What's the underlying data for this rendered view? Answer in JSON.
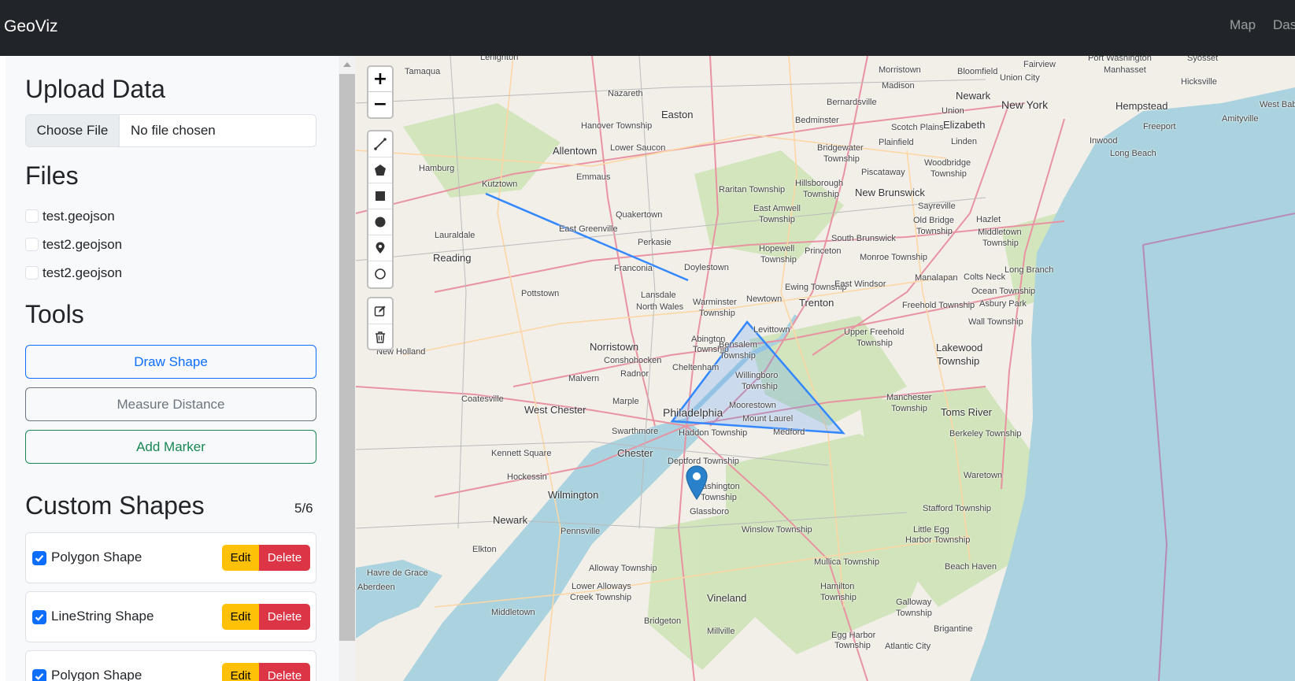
{
  "navbar": {
    "brand": "GeoViz",
    "links": [
      {
        "label": "Map"
      },
      {
        "label": "Dash"
      }
    ]
  },
  "upload": {
    "title": "Upload Data",
    "choose_label": "Choose File",
    "status": "No file chosen"
  },
  "files": {
    "title": "Files",
    "items": [
      {
        "label": "test.geojson"
      },
      {
        "label": "test2.geojson"
      },
      {
        "label": "test2.geojson"
      }
    ]
  },
  "tools": {
    "title": "Tools",
    "draw_shape": "Draw Shape",
    "measure_distance": "Measure Distance",
    "add_marker": "Add Marker"
  },
  "custom_shapes": {
    "title": "Custom Shapes",
    "count": "5/6",
    "edit_label": "Edit",
    "delete_label": "Delete",
    "items": [
      {
        "label": "Polygon Shape",
        "checked": true
      },
      {
        "label": "LineString Shape",
        "checked": true
      },
      {
        "label": "Polygon Shape",
        "checked": true
      }
    ]
  },
  "map": {
    "zoom_in": "+",
    "zoom_out": "−",
    "draw_tools": [
      "polyline-icon",
      "polygon-icon",
      "rectangle-icon",
      "circle-icon",
      "marker-icon",
      "circlemarker-icon"
    ],
    "edit_tools": [
      "edit-icon",
      "trash-icon"
    ],
    "places": {
      "lehighton": "Lehighton",
      "tamaqua": "Tamaqua",
      "nazareth": "Nazareth",
      "easton": "Easton",
      "hanover": "Hanover Township",
      "allentown": "Allentown",
      "lower_saucon": "Lower Saucon",
      "emmaus": "Emmaus",
      "hamburg": "Hamburg",
      "kutztown": "Kutztown",
      "quakertown": "Quakertown",
      "east_greenville": "East Greenville",
      "perkasie": "Perkasie",
      "lauraldale": "Lauraldale",
      "reading": "Reading",
      "franconia": "Franconia",
      "doylestown": "Doylestown",
      "pottstown": "Pottstown",
      "lansdale": "Lansdale",
      "north_wales": "North Wales",
      "warminster": "Warminster",
      "warminster_twp": "Township",
      "newtown": "Newtown",
      "trenton": "Trenton",
      "ewing": "Ewing Township",
      "levittown": "Levittown",
      "abington": "Abington",
      "abington_twp": "Township",
      "bensalem": "Bensalem",
      "bensalem_twp": "Township",
      "norristown": "Norristown",
      "conshohocken": "Conshohocken",
      "cheltenham": "Cheltenham",
      "new_holland": "New Holland",
      "malvern": "Malvern",
      "radnor": "Radnor",
      "willingboro": "Willingboro",
      "willingboro_twp": "Township",
      "coatesville": "Coatesville",
      "west_chester": "West Chester",
      "marple": "Marple",
      "philadelphia": "Philadelphia",
      "moorestown": "Moorestown",
      "mount_laurel": "Mount Laurel",
      "swarthmore": "Swarthmore",
      "haddon": "Haddon Township",
      "medford": "Medford",
      "chester": "Chester",
      "kennett": "Kennett Square",
      "deptford": "Deptford Township",
      "hockessin": "Hockessin",
      "washington": "Washington",
      "washington_twp": "Township",
      "wilmington": "Wilmington",
      "glassboro": "Glassboro",
      "newark_de": "Newark",
      "pennsville": "Pennsville",
      "winslow": "Winslow Township",
      "elkton": "Elkton",
      "alloway": "Alloway Township",
      "havre": "Havre de Grace",
      "aberdeen": "Aberdeen",
      "lower_alloways": "Lower Alloways",
      "creek": "Creek Township",
      "vineland": "Vineland",
      "middletown_de": "Middletown",
      "bridgeton": "Bridgeton",
      "millville": "Millville",
      "mullica": "Mullica Township",
      "hamilton": "Hamilton",
      "hamilton_twp": "Township",
      "egg_harbor": "Egg Harbor",
      "egg_harbor_twp": "Township",
      "atlantic_city": "Atlantic City",
      "galloway": "Galloway",
      "galloway_twp": "Township",
      "brigantine": "Brigantine",
      "beach_haven": "Beach Haven",
      "little_egg": "Little Egg",
      "little_egg_harbor": "Harbor Township",
      "stafford": "Stafford Township",
      "waretown": "Waretown",
      "berkeley": "Berkeley Township",
      "toms_river": "Toms River",
      "manchester": "Manchester",
      "manchester_twp": "Township",
      "lakewood": "Lakewood",
      "lakewood_twp": "Township",
      "upper_freehold": "Upper Freehold",
      "upper_freehold_twp": "Township",
      "wall": "Wall Township",
      "freehold": "Freehold Township",
      "asbury": "Asbury Park",
      "ocean": "Ocean Township",
      "long_branch": "Long Branch",
      "east_windsor": "East Windsor",
      "manalapan": "Manalapan",
      "colts_neck": "Colts Neck",
      "hopewell": "Hopewell",
      "hopewell_twp": "Township",
      "princeton": "Princeton",
      "monroe": "Monroe Township",
      "south_brunswick": "South Brunswick",
      "east_amwell": "East Amwell",
      "east_amwell_twp": "Township",
      "raritan": "Raritan Township",
      "hillsborough": "Hillsborough",
      "hillsborough_twp": "Township",
      "new_brunswick": "New Brunswick",
      "sayreville": "Sayreville",
      "old_bridge": "Old Bridge",
      "old_bridge_twp": "Township",
      "hazlet": "Hazlet",
      "middletown_nj": "Middletown",
      "middletown_nj_twp": "Township",
      "piscataway": "Piscataway",
      "woodbridge": "Woodbridge",
      "woodbridge_twp": "Township",
      "bridgewater": "Bridgewater",
      "bridgewater_twp": "Township",
      "plainfield": "Plainfield",
      "scotch_plains": "Scotch Plains",
      "linden": "Linden",
      "elizabeth": "Elizabeth",
      "union": "Union",
      "bedminster": "Bedminster",
      "bernardsville": "Bernardsville",
      "madison": "Madison",
      "morristown": "Morristown",
      "newark": "Newark",
      "new_york": "New York",
      "bloomfield": "Bloomfield",
      "union_city": "Union City",
      "fairview": "Fairview",
      "port_washington": "Port Washington",
      "manhasset": "Manhasset",
      "syosset": "Syosset",
      "hicksville": "Hicksville",
      "hempstead": "Hempstead",
      "west_bab": "West Bab",
      "amityville": "Amityville",
      "freeport": "Freeport",
      "inwood": "Inwood",
      "long_beach": "Long Beach"
    }
  }
}
